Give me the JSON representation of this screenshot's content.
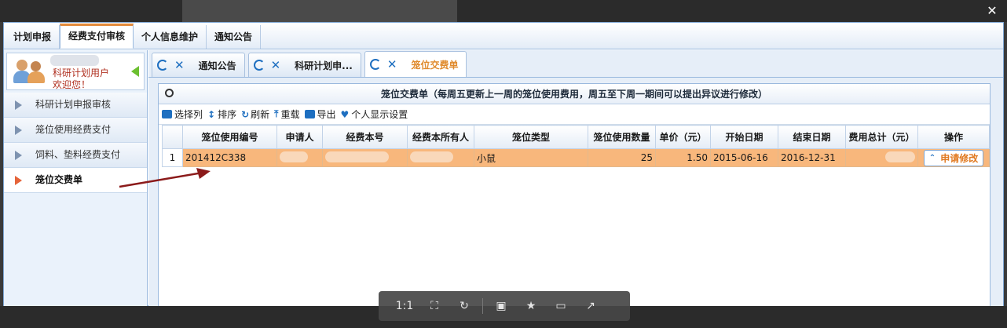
{
  "top_nav": {
    "tabs": [
      {
        "label": "计划申报",
        "active": false
      },
      {
        "label": "经费支付审核",
        "active": true
      },
      {
        "label": "个人信息维护",
        "active": false
      },
      {
        "label": "通知公告",
        "active": false
      }
    ]
  },
  "user": {
    "role": "科研计划用户",
    "welcome": "欢迎您！"
  },
  "sidebar": {
    "items": [
      {
        "label": "科研计划申报审核",
        "active": false
      },
      {
        "label": "笼位使用经费支付",
        "active": false
      },
      {
        "label": "饲料、垫料经费支付",
        "active": false
      },
      {
        "label": "笼位交费单",
        "active": true
      }
    ]
  },
  "content_tabs": [
    {
      "label": "通知公告",
      "active": false
    },
    {
      "label": "科研计划申...",
      "active": false
    },
    {
      "label": "笼位交费单",
      "active": true
    }
  ],
  "panel": {
    "title": "笼位交费单（每周五更新上一周的笼位使用费用，周五至下周一期间可以提出异议进行修改）"
  },
  "toolbar": {
    "select_cols": "选择列",
    "sort": "排序",
    "refresh": "刷新",
    "reload": "重载",
    "export": "导出",
    "personal_display": "个人显示设置"
  },
  "table": {
    "columns": [
      "笼位使用编号",
      "申请人",
      "经费本号",
      "经费本所有人",
      "笼位类型",
      "笼位使用数量",
      "单价（元）",
      "开始日期",
      "结束日期",
      "费用总计（元）",
      "操作"
    ],
    "rows": [
      {
        "index": "1",
        "cage_use_no": "201412C338",
        "cage_type": "小鼠",
        "quantity": "25",
        "unit_price": "1.50",
        "start_date": "2015-06-16",
        "end_date": "2016-12-31",
        "action": "申请修改"
      }
    ]
  },
  "viewer": {
    "zoom_label": "1:1"
  },
  "colors": {
    "accent_orange": "#e08a2c",
    "row_highlight": "#f8b77c",
    "link_blue": "#1e6fc0",
    "annotation_red": "#8b1a1a"
  }
}
